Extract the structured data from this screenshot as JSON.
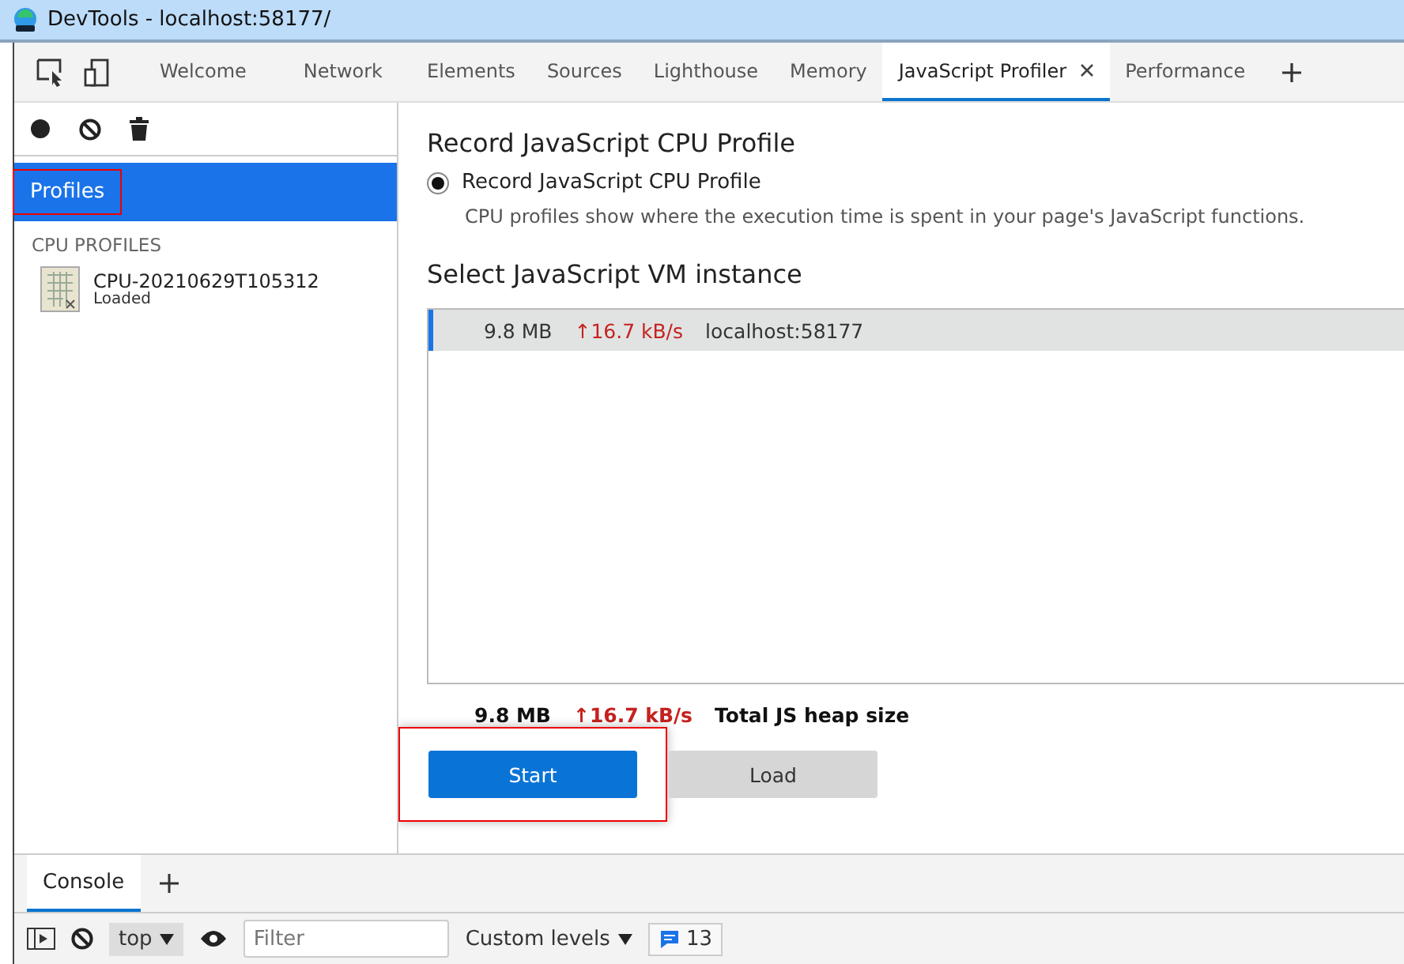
{
  "window": {
    "title": "DevTools - localhost:58177/"
  },
  "tabs": [
    {
      "label": "Welcome",
      "selected": false,
      "closable": false
    },
    {
      "label": "Network",
      "selected": false,
      "closable": false
    },
    {
      "label": "Elements",
      "selected": false,
      "closable": false
    },
    {
      "label": "Sources",
      "selected": false,
      "closable": false
    },
    {
      "label": "Lighthouse",
      "selected": false,
      "closable": false
    },
    {
      "label": "Memory",
      "selected": false,
      "closable": false
    },
    {
      "label": "JavaScript Profiler",
      "selected": true,
      "closable": true
    },
    {
      "label": "Performance",
      "selected": false,
      "closable": false
    }
  ],
  "sidebar": {
    "header": {
      "label": "Profiles",
      "selected": true,
      "highlighted": true
    },
    "section": "CPU PROFILES",
    "profiles": [
      {
        "name": "CPU-20210629T105312",
        "status": "Loaded"
      }
    ]
  },
  "main": {
    "heading": "Record JavaScript CPU Profile",
    "option": {
      "label": "Record JavaScript CPU Profile",
      "selected": true
    },
    "description": "CPU profiles show where the execution time is spent in your page's JavaScript functions.",
    "vm_heading": "Select JavaScript VM instance",
    "instances": [
      {
        "size": "9.8 MB",
        "rate": "↑16.7 kB/s",
        "name": "localhost:58177",
        "selected": true
      }
    ],
    "summary": {
      "size": "9.8 MB",
      "rate": "↑16.7 kB/s",
      "label": "Total JS heap size"
    },
    "buttons": [
      {
        "label": "Start",
        "kind": "primary",
        "highlighted": true
      },
      {
        "label": "Load",
        "kind": "secondary",
        "highlighted": false
      }
    ]
  },
  "drawer": {
    "tabs": [
      {
        "label": "Console",
        "selected": true
      }
    ],
    "context": "top",
    "filter": {
      "placeholder": "Filter"
    },
    "levels": "Custom levels",
    "issues": "13"
  }
}
